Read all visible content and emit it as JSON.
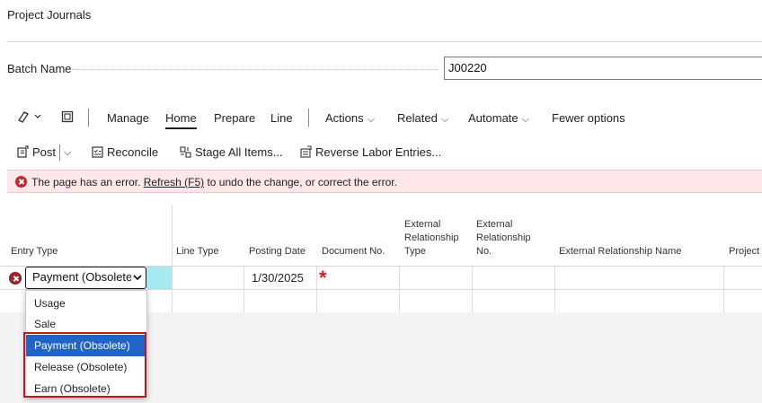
{
  "page": {
    "title": "Project Journals"
  },
  "batch": {
    "label": "Batch Name",
    "value": "J00220"
  },
  "actionbar": {
    "tabs": [
      "Manage",
      "Home",
      "Prepare",
      "Line"
    ],
    "menus": [
      "Actions",
      "Related",
      "Automate"
    ],
    "fewer_options": "Fewer options"
  },
  "commands": {
    "post": "Post",
    "reconcile": "Reconcile",
    "stage_all": "Stage All Items...",
    "reverse_labor": "Reverse Labor Entries..."
  },
  "error": {
    "prefix": "The page has an error.",
    "link": "Refresh (F5)",
    "suffix": "to undo the change, or correct the error."
  },
  "grid": {
    "headers": {
      "entry_type": "Entry Type",
      "line_type": "Line Type",
      "posting_date": "Posting Date",
      "document_no": "Document No.",
      "ext_rel_type": "External Relationship Type",
      "ext_rel_no": "External Relationship No.",
      "ext_rel_name": "External Relationship Name",
      "project": "Project"
    },
    "row1": {
      "entry_type": "Payment (Obsolete)",
      "posting_date": "1/30/2025",
      "required_marker": "*"
    }
  },
  "dropdown": {
    "options": [
      "Usage",
      "Sale",
      "Payment (Obsolete)",
      "Release (Obsolete)",
      "Earn (Obsolete)"
    ],
    "selected": "Payment (Obsolete)"
  },
  "colors": {
    "accent": "#2064c9",
    "error": "#c4262e",
    "error_bg": "#fde7e9",
    "active_cell": "#a6e9f0"
  }
}
